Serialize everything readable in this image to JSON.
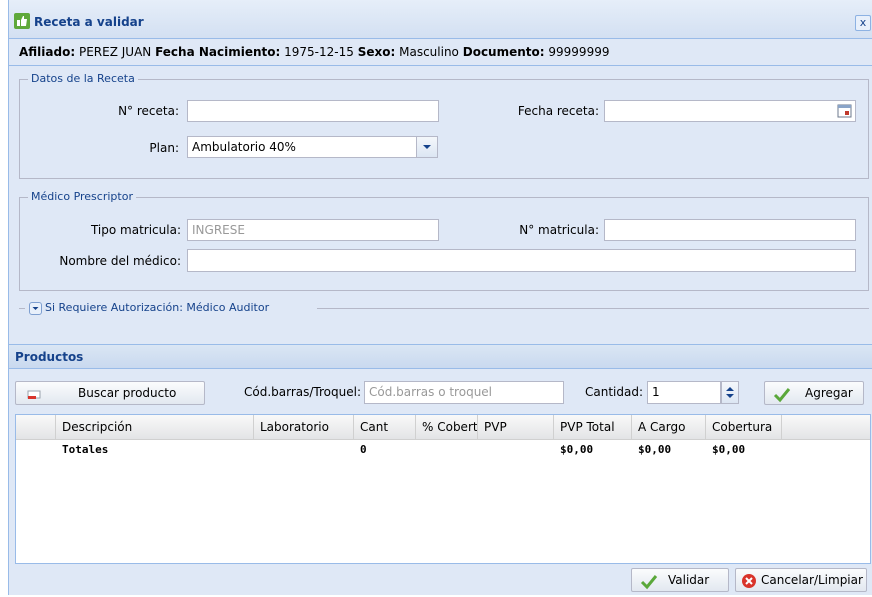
{
  "window": {
    "title": "Receta a validar",
    "close_label": "x"
  },
  "affiliate": {
    "affiliate_label": "Afiliado:",
    "affiliate_value": "PEREZ JUAN",
    "birth_label": "Fecha Nacimiento:",
    "birth_value": "1975-12-15",
    "sex_label": "Sexo:",
    "sex_value": "Masculino",
    "doc_label": "Documento:",
    "doc_value": "99999999"
  },
  "receta": {
    "legend": "Datos de la Receta",
    "numero_label": "N° receta:",
    "numero_value": "",
    "fecha_label": "Fecha receta:",
    "fecha_value": "",
    "plan_label": "Plan:",
    "plan_value": "Ambulatorio 40%"
  },
  "medico": {
    "legend": "Médico Prescriptor",
    "tipo_label": "Tipo matricula:",
    "tipo_placeholder": "INGRESE",
    "matricula_label": "N° matricula:",
    "matricula_value": "",
    "nombre_label": "Nombre del médico:",
    "nombre_value": ""
  },
  "auditor": {
    "label": "Si Requiere Autorización: Médico Auditor"
  },
  "productos": {
    "title": "Productos",
    "buscar_label": "Buscar producto",
    "codbarras_label": "Cód.barras/Troquel:",
    "codbarras_placeholder": "Cód.barras o troquel",
    "cantidad_label": "Cantidad:",
    "cantidad_value": "1",
    "agregar_label": "Agregar"
  },
  "grid": {
    "columns": [
      "Descripción",
      "Laboratorio",
      "Cant",
      "% Cobert",
      "PVP",
      "PVP Total",
      "A Cargo",
      "Cobertura"
    ],
    "totals": {
      "label": "Totales",
      "cant": "0",
      "pvp_total": "$0,00",
      "a_cargo": "$0,00",
      "cobertura": "$0,00"
    }
  },
  "footer": {
    "validar_label": "Validar",
    "cancelar_label": "Cancelar/Limpiar"
  },
  "colors": {
    "window_bg": "#dfe8f6",
    "title_text": "#15428b",
    "border": "#99bbe8"
  },
  "icons": {
    "title": "thumbs-up-icon",
    "close": "close-icon",
    "calendar": "calendar-icon",
    "dropdown": "chevron-down-icon",
    "collapse": "chevron-down-icon",
    "search": "search-product-icon",
    "spinner": "spinner-icon",
    "check": "check-icon",
    "cancel": "cancel-icon"
  }
}
